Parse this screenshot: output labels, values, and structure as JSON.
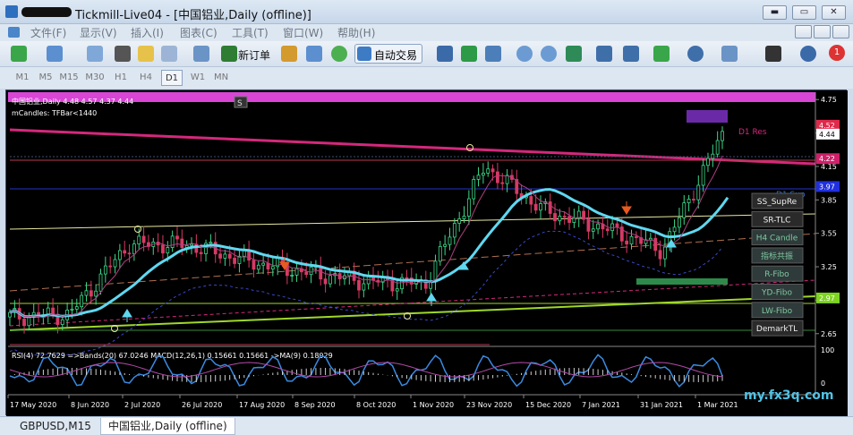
{
  "window": {
    "title": "Tickmill-Live04 - [中国铝业,Daily (offline)]",
    "min": "▬",
    "restore": "▭",
    "close": "✕"
  },
  "menu": [
    "文件(F)",
    "显示(V)",
    "插入(I)",
    "图表(C)",
    "工具(T)",
    "窗口(W)",
    "帮助(H)"
  ],
  "toolbar": {
    "new_order": "新订单",
    "auto_trade": "自动交易",
    "notification_count": "1"
  },
  "periods": [
    "M1",
    "M5",
    "M15",
    "M30",
    "H1",
    "H4",
    "D1",
    "W1",
    "MN"
  ],
  "active_period": "D1",
  "chart": {
    "header_line1": "中国铝业,Daily  4.48 4.57 4.37 4.44",
    "header_line2": "mCandles: TFBar<1440",
    "s_badge": "S",
    "d1res_label": "D1 Res",
    "d1sup_label": "D1 Sup",
    "panel_buttons": [
      "SS_SupRe",
      "SR-TLC",
      "H4 Candle",
      "指标共振",
      "R-Fibo",
      "YD-Fibo",
      "LW-Fibo",
      "DemarkTL"
    ],
    "price_ticks": [
      "4.75",
      "4.45",
      "4.15",
      "3.85",
      "3.55",
      "3.25",
      "2.95",
      "2.65"
    ],
    "price_tags": [
      {
        "text": "4.52",
        "color": "#e0284a"
      },
      {
        "text": "4.44",
        "color": "#ffffff"
      },
      {
        "text": "4.22",
        "color": "#d0206a"
      },
      {
        "text": "3.97",
        "color": "#2030e0"
      },
      {
        "text": "2.97",
        "color": "#7ed321"
      }
    ],
    "indicator_label": "RSI(4) 72.7629  =>Bands(20) 67.0246  MACD(12,26,1) 0.15661 0.15661  ->MA(9) 0.18029",
    "ind_ticks": [
      "100",
      "0"
    ],
    "date_ticks": [
      "17 May 2020",
      "8 Jun 2020",
      "2 Jul 2020",
      "26 Jul 2020",
      "17 Aug 2020",
      "8 Sep 2020",
      "8 Oct 2020",
      "1 Nov 2020",
      "23 Nov 2020",
      "15 Dec 2020",
      "7 Jan 2021",
      "31 Jan 2021",
      "1 Mar 2021"
    ],
    "watermark": "my.fx3q.com"
  },
  "tabs": [
    "GBPUSD,M15",
    "中国铝业,Daily (offline)"
  ],
  "active_tab": "中国铝业,Daily (offline)",
  "chart_data": {
    "type": "candlestick",
    "title": "中国铝业,Daily",
    "last_bar": {
      "open": 4.48,
      "high": 4.57,
      "low": 4.37,
      "close": 4.44
    },
    "ylim": [
      2.6,
      4.8
    ],
    "x": [
      "17 May 2020",
      "8 Jun 2020",
      "2 Jul 2020",
      "26 Jul 2020",
      "17 Aug 2020",
      "8 Sep 2020",
      "8 Oct 2020",
      "1 Nov 2020",
      "23 Nov 2020",
      "15 Dec 2020",
      "7 Jan 2021",
      "31 Jan 2021",
      "1 Mar 2021"
    ],
    "close_approx": [
      2.8,
      2.82,
      3.45,
      3.45,
      3.3,
      3.2,
      3.12,
      3.1,
      4.15,
      3.75,
      3.6,
      3.4,
      4.44
    ]
  }
}
